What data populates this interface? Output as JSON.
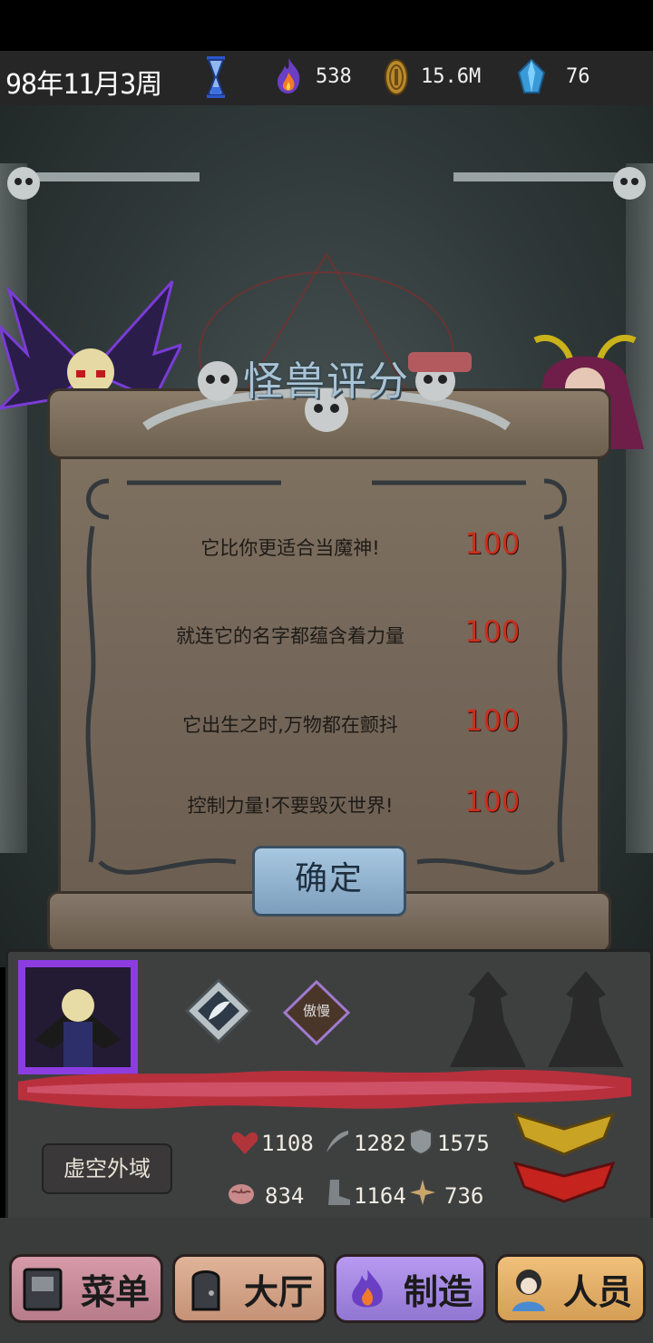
{
  "status": {
    "date": "98年11月3周",
    "flame_value": "538",
    "coin_value": "15.6M",
    "gem_value": "76"
  },
  "dialog": {
    "title": "怪兽评分",
    "rows": [
      {
        "text": "它比你更适合当魔神!",
        "score": "100"
      },
      {
        "text": "就连它的名字都蕴含着力量",
        "score": "100"
      },
      {
        "text": "它出生之时,万物都在颤抖",
        "score": "100"
      },
      {
        "text": "控制力量!不要毁灭世界!",
        "score": "100"
      }
    ],
    "confirm_label": "确定"
  },
  "panel": {
    "crest_label": "傲慢",
    "location": "虚空外域",
    "stats": {
      "hp": "1108",
      "attack": "1282",
      "defense": "1575",
      "intellect": "834",
      "speed": "1164",
      "magic": "736"
    }
  },
  "nav": {
    "menu": "菜单",
    "hall": "大厅",
    "craft": "制造",
    "staff": "人员"
  },
  "colors": {
    "score_red": "#c7301f",
    "title_blue": "#a9c3d6",
    "scroll_tan": "#7f715f"
  }
}
